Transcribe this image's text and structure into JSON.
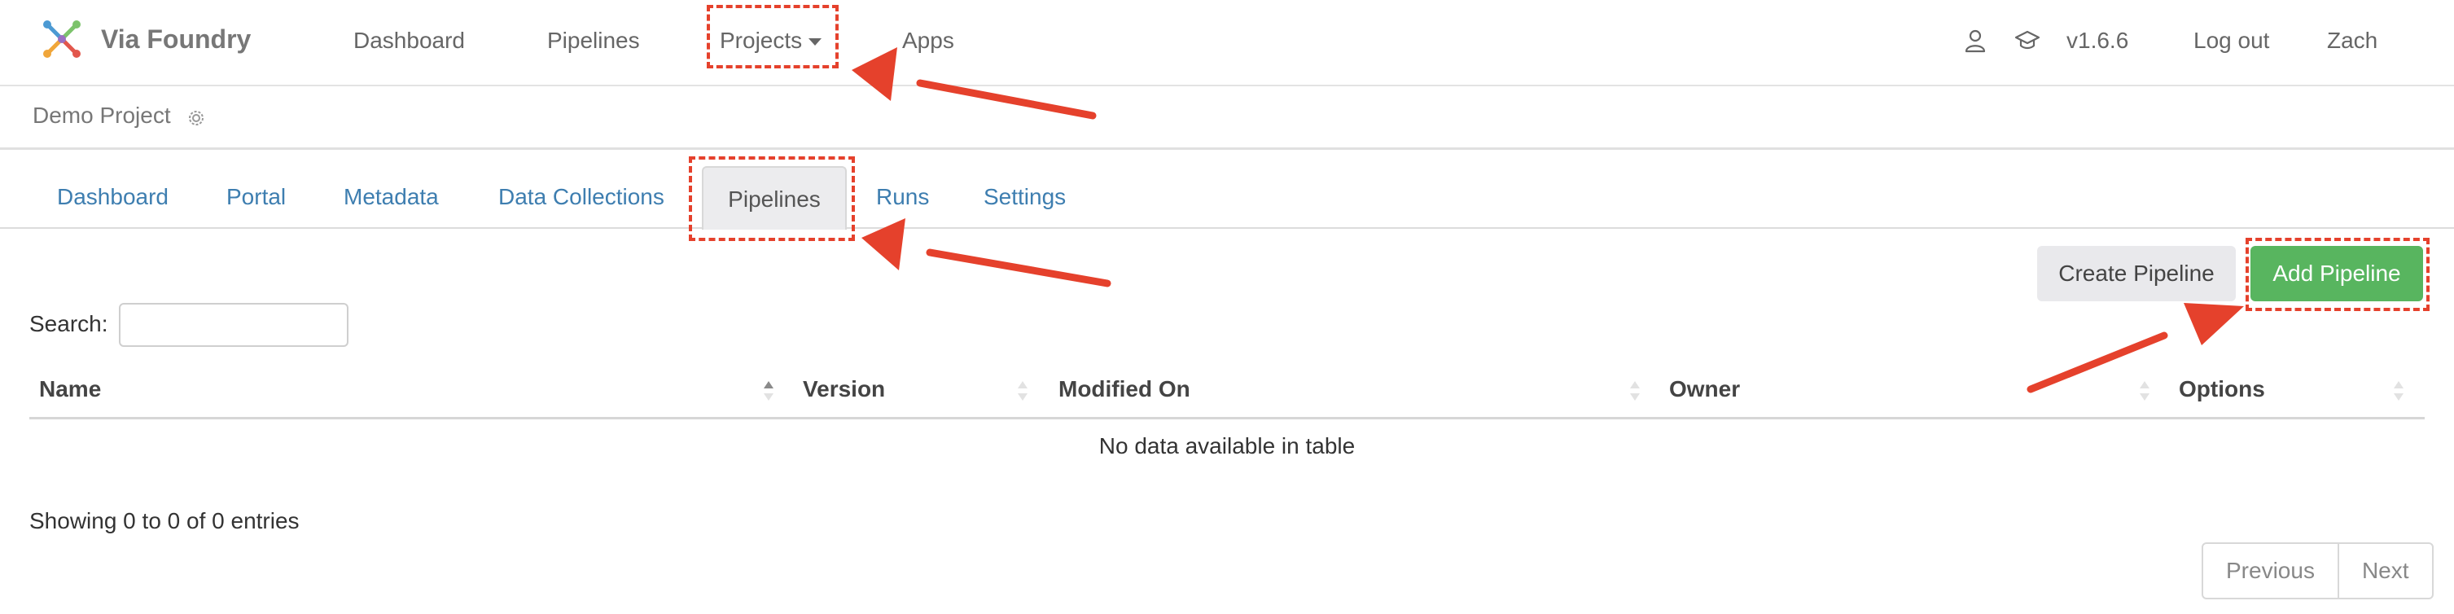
{
  "brand": {
    "name": "Via Foundry"
  },
  "navbar": {
    "items": [
      {
        "label": "Dashboard"
      },
      {
        "label": "Pipelines"
      },
      {
        "label": "Projects"
      },
      {
        "label": "Apps"
      }
    ],
    "version": "v1.6.6",
    "logout": "Log out",
    "user": "Zach",
    "icons": [
      "user-icon",
      "graduation-cap-icon"
    ]
  },
  "project": {
    "title": "Demo Project"
  },
  "tabs": [
    {
      "label": "Dashboard"
    },
    {
      "label": "Portal"
    },
    {
      "label": "Metadata"
    },
    {
      "label": "Data Collections"
    },
    {
      "label": "Pipelines"
    },
    {
      "label": "Runs"
    },
    {
      "label": "Settings"
    }
  ],
  "buttons": {
    "create": "Create Pipeline",
    "add": "Add Pipeline"
  },
  "search": {
    "label": "Search:",
    "value": ""
  },
  "table": {
    "columns": [
      "Name",
      "Version",
      "Modified On",
      "Owner",
      "Options"
    ],
    "empty": "No data available in table",
    "info": "Showing 0 to 0 of 0 entries"
  },
  "pagination": {
    "previous": "Previous",
    "next": "Next"
  },
  "colors": {
    "accent": "#58b55f",
    "link": "#3e7eb0",
    "annotation": "#e5412c"
  }
}
